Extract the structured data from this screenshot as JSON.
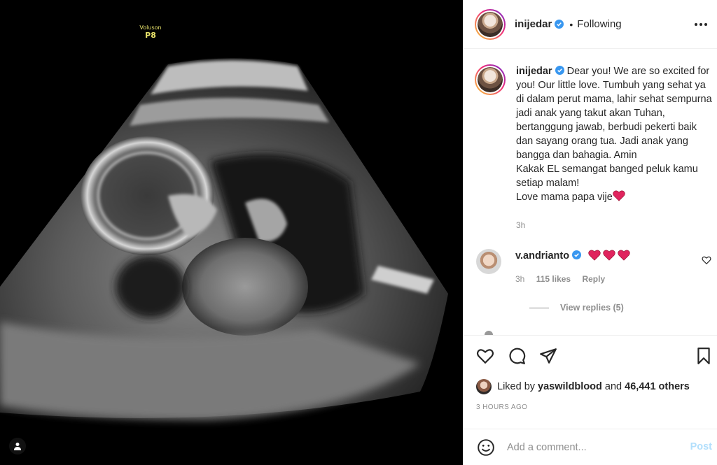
{
  "media": {
    "machine_brand": "Voluson",
    "machine_model": "P8"
  },
  "header": {
    "username": "inijedar",
    "separator": "•",
    "follow_status": "Following"
  },
  "caption": {
    "username": "inijedar",
    "text": "Dear you! We are so excited for you! Our little love. Tumbuh yang sehat ya di dalam perut mama, lahir sehat sempurna jadi anak yang takut akan Tuhan, bertanggung jawab, berbudi pekerti baik dan sayang orang tua. Jadi anak yang bangga dan bahagia. Amin\nKakak EL semangat banged peluk kamu setiap malam!\nLove mama papa vije",
    "time": "3h"
  },
  "comment": {
    "username": "v.andrianto",
    "time": "3h",
    "likes": "115 likes",
    "reply_label": "Reply",
    "view_replies": "View replies (5)"
  },
  "likes": {
    "prefix": "Liked by",
    "user": "yaswildblood",
    "conjunction": "and",
    "others": "46,441 others"
  },
  "post_time": "3 HOURS AGO",
  "add_comment": {
    "placeholder": "Add a comment...",
    "post_label": "Post"
  },
  "colors": {
    "verified": "#3897f0",
    "heart": "#e0245e",
    "muted_text": "#8e8e8e",
    "post_disabled": "#b2dffc"
  },
  "icons": [
    "more-icon",
    "verified-icon",
    "heart-emoji-icon",
    "heart-outline-icon",
    "comment-icon",
    "share-icon",
    "bookmark-icon",
    "emoji-icon",
    "user-tag-icon"
  ]
}
